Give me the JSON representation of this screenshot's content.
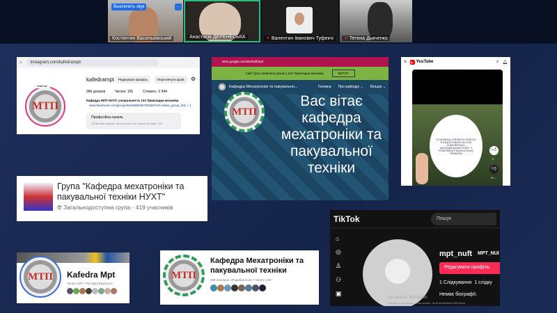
{
  "participants": [
    {
      "name": "Костянтин Васильківський",
      "button": "Выключить звук",
      "more": "···"
    },
    {
      "name": "Анастасія ДЕРЕНЕСЬКА"
    },
    {
      "name": "Валентин Іванович Туфекчі"
    },
    {
      "name": "Тетяна Дьяченко"
    }
  ],
  "instagram": {
    "url": "instagram.com/kafedrampt/",
    "username": "kafedrampt",
    "edit": "Редагувати профіль",
    "archive": "Переглянути архів",
    "posts": "966 дописів",
    "followers": "Читачі: 105",
    "following": "Стежить: 2 944",
    "bio": "Кафедра МПТ НУХТ, спеціальність 131 Прикладна механіка",
    "link": "www.facebook.com/groups/641695936720285/?ref=share_group_link + 1",
    "panel_title": "Професійна панель",
    "panel_text": "Облікових записів, які охоплено за останні 30 днів: 207.",
    "note": "Замітка..."
  },
  "sites": {
    "url": "sites.google.com/site/kaftmpt/",
    "banner": "Сайт було оновлено разом з 131 Прикладна механіка",
    "banner_btn": "ВСТУП",
    "site_name": "Кафедра Мехатроніки та пакувально...",
    "nav": [
      "Головна",
      "Про кафедру ⌄",
      "Більше ⌄"
    ],
    "hero": "Вас вітає кафедра мехатроніки та пакувальної техніки"
  },
  "youtube": {
    "brand": "YouTube",
    "card_text": "ТИ МОЖЕШ СТВОРИТИ РОБОТА Й АКЦЕНТУВАТИ НА РОЛІ ІНЖЕНЕРНИХ І ДОСЛІДНИЦЬКИХ РОБІТ У РОЗВ'ЯЗАННІ ЕКОЛОГІЧНИХ ПРОБЛЕМ",
    "likes": "2",
    "dislike": "Ні..."
  },
  "fb_group": {
    "title": "Група \"Кафедра мехатроніки та пакувальної техніки НУХТ\"",
    "meta": "Загальнодоступна група · 419 учасників"
  },
  "tiktok": {
    "brand": "TikTok",
    "search": "Пошук",
    "username": "mpt_nuft",
    "display": "MPT_NUI",
    "edit": "Редагувати профіль",
    "following": "1 Слідкування",
    "followers": "1 слідку",
    "bio": "Немає біографії.",
    "watermark1": "Активація Windows",
    "watermark2": "Перейдіть до розділу \"Настройки\", щоб активувати Windows."
  },
  "fb_profile": {
    "name": "Kafedra Mpt",
    "meta": "читачі: 607 • 752 відстежуються"
  },
  "fb_page": {
    "name": "Кафедра Мехатроніки та пакувальної техніки",
    "meta": "209 позначок «Подобається» • читачі: 230"
  },
  "logo_text": "МТП"
}
